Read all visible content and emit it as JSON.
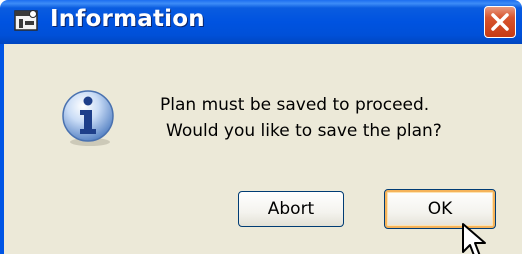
{
  "window": {
    "title": "Information",
    "title_icon": "app-window-icon",
    "close_icon": "close-icon"
  },
  "dialog": {
    "icon": "info-icon",
    "message_line1": "Plan must be saved to proceed.",
    "message_line2": "Would you like to save the plan?"
  },
  "buttons": {
    "abort_label": "Abort",
    "ok_label": "OK"
  },
  "colors": {
    "titlebar_blue": "#0053e0",
    "body_bg": "#ece9d8",
    "close_red": "#d8552f",
    "focus_orange": "#f5b35a"
  }
}
